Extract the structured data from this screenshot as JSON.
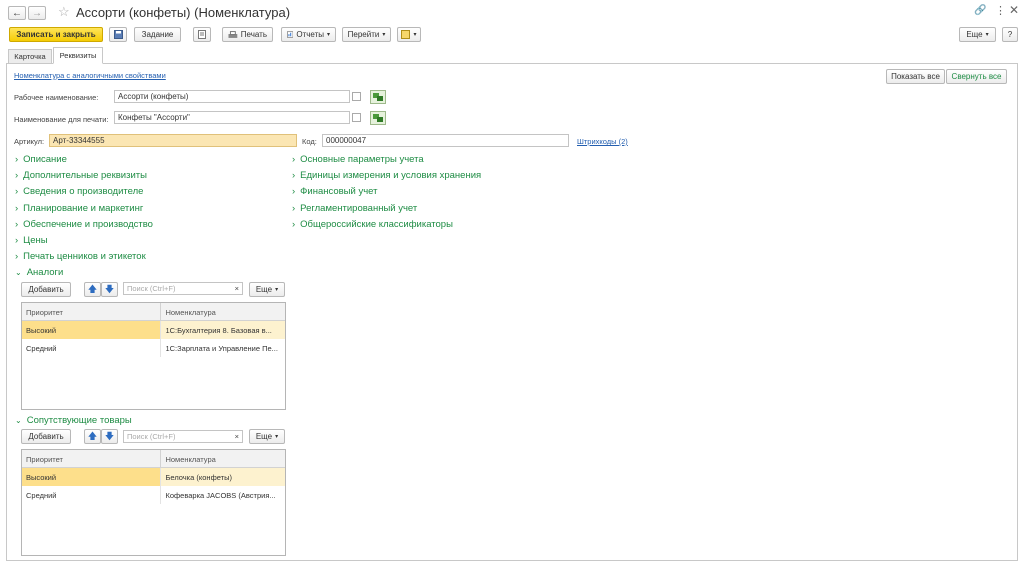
{
  "window": {
    "title": "Ассорти (конфеты) (Номенклатура)"
  },
  "toolbar": {
    "save_close": "Записать и закрыть",
    "task": "Задание",
    "print": "Печать",
    "reports": "Отчеты",
    "goto": "Перейти",
    "more": "Еще",
    "help": "?"
  },
  "tabs": [
    "Карточка",
    "Реквизиты"
  ],
  "form": {
    "analog_link": "Номенклатура с аналогичными свойствами",
    "show_all": "Показать все",
    "collapse_all": "Свернуть все",
    "work_name_label": "Рабочее наименование:",
    "work_name_value": "Ассорти (конфеты)",
    "print_name_label": "Наименование для печати:",
    "print_name_value": "Конфеты \"Ассорти\"",
    "article_label": "Артикул:",
    "article_value": "Арт-33344555",
    "code_label": "Код:",
    "code_value": "000000047",
    "barcodes_link": "Штрихкоды (2)"
  },
  "groups_left": [
    "Описание",
    "Дополнительные реквизиты",
    "Сведения о производителе",
    "Планирование и маркетинг",
    "Обеспечение и производство",
    "Цены",
    "Печать ценников и этикеток"
  ],
  "groups_right": [
    "Основные параметры учета",
    "Единицы измерения и условия хранения",
    "Финансовый учет",
    "Регламентированный учет",
    "Общероссийские классификаторы"
  ],
  "analogs": {
    "title": "Аналоги",
    "add": "Добавить",
    "search_placeholder": "Поиск (Ctrl+F)",
    "more": "Еще",
    "columns": [
      "Приоритет",
      "Номенклатура"
    ],
    "rows": [
      [
        "Высокий",
        "1С:Бухгалтерия 8. Базовая в..."
      ],
      [
        "Средний",
        "1С:Зарплата и Управление Пе..."
      ]
    ]
  },
  "related": {
    "title": "Сопутствующие товары",
    "add": "Добавить",
    "search_placeholder": "Поиск (Ctrl+F)",
    "more": "Еще",
    "columns": [
      "Приоритет",
      "Номенклатура"
    ],
    "rows": [
      [
        "Высокий",
        "Белочка (конфеты)"
      ],
      [
        "Средний",
        "Кофеварка JACOBS (Австрия..."
      ]
    ]
  },
  "colors": {
    "accent": "#f5cc05",
    "group_green": "#1e8c44",
    "link_blue": "#245fb0",
    "highlight": "#fbe6b3"
  }
}
